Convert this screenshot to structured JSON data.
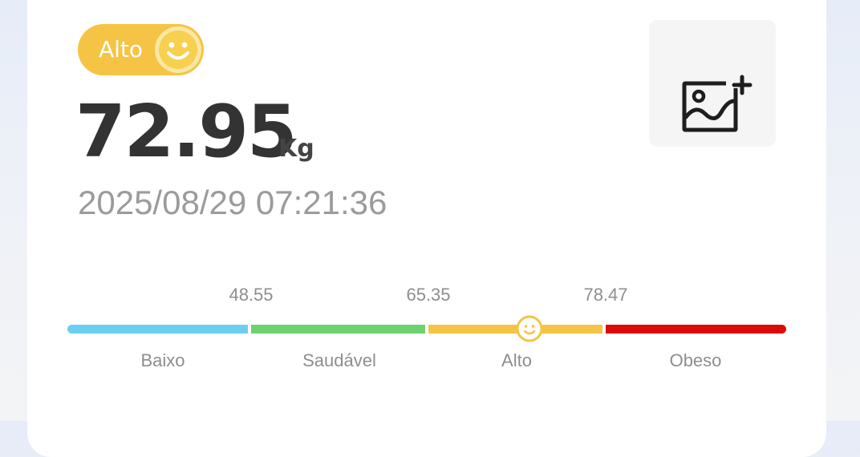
{
  "status": {
    "label": "Alto",
    "icon": "smiley-icon",
    "color": "#f5c444"
  },
  "measurement": {
    "weight": "72.95",
    "unit": "Kg",
    "datetime": "2025/08/29 07:21:36"
  },
  "add_photo": {
    "icon": "add-image-icon"
  },
  "scale": {
    "thresholds": [
      "48.55",
      "65.35",
      "78.47"
    ],
    "categories": [
      {
        "label": "Baixo",
        "color": "#6ccff0"
      },
      {
        "label": "Saudável",
        "color": "#6cd36f"
      },
      {
        "label": "Alto",
        "color": "#f5c444"
      },
      {
        "label": "Obeso",
        "color": "#dd0a0a"
      }
    ],
    "current_value": 72.95,
    "marker_icon": "smiley-icon"
  }
}
